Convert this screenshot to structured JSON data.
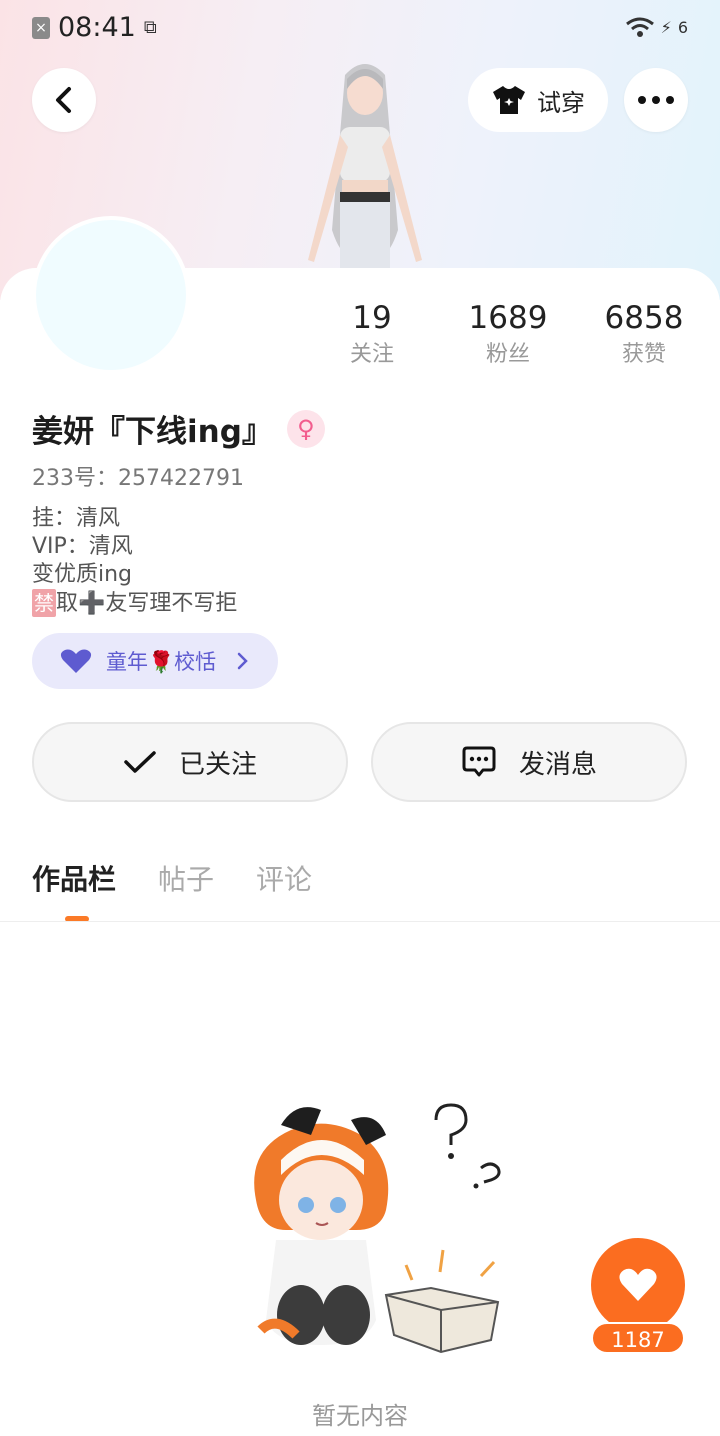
{
  "status_bar": {
    "time": "08:41",
    "battery": "6"
  },
  "header": {
    "try_on_label": "试穿"
  },
  "profile": {
    "stats": [
      {
        "value": "19",
        "label": "关注"
      },
      {
        "value": "1689",
        "label": "粉丝"
      },
      {
        "value": "6858",
        "label": "获赞"
      }
    ],
    "name": "姜妍『下线ing』",
    "gender_symbol": "♀",
    "uid": "233号：257422791",
    "bio": {
      "line1": "挂：清风",
      "line2": "VIP：清风",
      "line3": "变优质ing",
      "line4_badge": "禁",
      "line4_rest": "取➕友写理不写拒"
    },
    "guild_label": "童年🌹校恬"
  },
  "actions": {
    "follow_label": "已关注",
    "message_label": "发消息"
  },
  "tabs": [
    {
      "label": "作品栏"
    },
    {
      "label": "帖子"
    },
    {
      "label": "评论"
    }
  ],
  "empty_state": {
    "text": "暂无内容"
  },
  "like": {
    "count": "1187"
  },
  "colors": {
    "accent": "#fb6d20",
    "guild_text": "#5e5bd0",
    "guild_bg": "#e9e9fb"
  }
}
